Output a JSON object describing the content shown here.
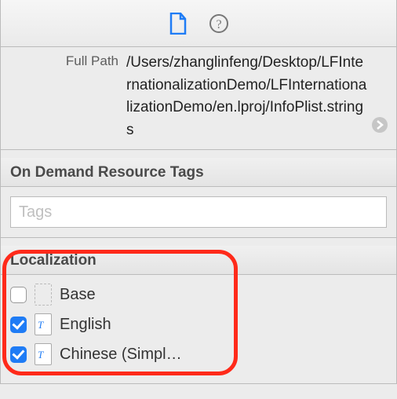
{
  "toolbar": {
    "file_icon": "file-icon",
    "help_icon": "help-icon"
  },
  "identity": {
    "full_path_label": "Full Path",
    "full_path_value": "/Users/zhanglinfeng/Desktop/LFInternationalizationDemo/LFInternationalizationDemo/en.lproj/InfoPlist.strings"
  },
  "on_demand": {
    "header": "On Demand Resource Tags",
    "placeholder": "Tags",
    "value": ""
  },
  "localization": {
    "header": "Localization",
    "items": [
      {
        "label": "Base",
        "checked": false,
        "file": "none"
      },
      {
        "label": "English",
        "checked": true,
        "file": "strings"
      },
      {
        "label": "Chinese (Simpl…",
        "checked": true,
        "file": "strings"
      }
    ]
  }
}
